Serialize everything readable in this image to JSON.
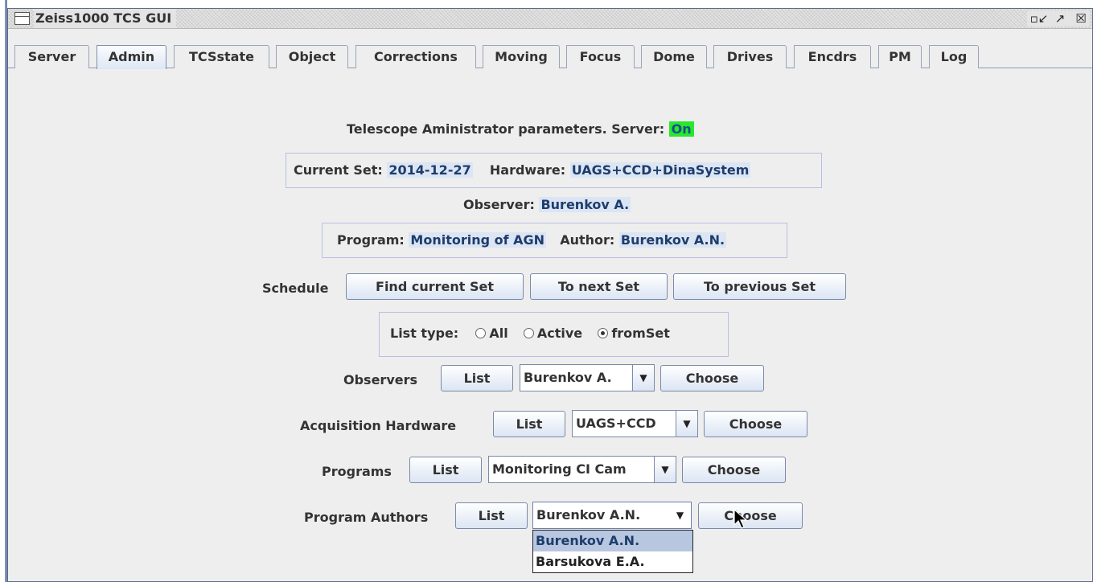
{
  "window": {
    "title": "Zeiss1000 TCS GUI",
    "controls": [
      "▫↙",
      "↗",
      "☒"
    ]
  },
  "tabs": [
    {
      "label": "Server",
      "selected": false
    },
    {
      "label": "Admin",
      "selected": true
    },
    {
      "label": "TCSstate",
      "selected": false
    },
    {
      "label": "Object",
      "selected": false
    },
    {
      "label": "Corrections",
      "selected": false
    },
    {
      "label": "Moving",
      "selected": false
    },
    {
      "label": "Focus",
      "selected": false
    },
    {
      "label": "Dome",
      "selected": false
    },
    {
      "label": "Drives",
      "selected": false
    },
    {
      "label": "Encdrs",
      "selected": false
    },
    {
      "label": "PM",
      "selected": false
    },
    {
      "label": "Log",
      "selected": false
    }
  ],
  "header": {
    "text": "Telescope Aministrator parameters.  Server:",
    "server_status": "On",
    "server_status_color": "#27e82c"
  },
  "current_set": {
    "label": "Current Set:",
    "value": "2014-12-27",
    "hardware_label": "Hardware:",
    "hardware_value": "UAGS+CCD+DinaSystem"
  },
  "observer": {
    "label": "Observer:",
    "value": "Burenkov A."
  },
  "program": {
    "label": "Program:",
    "value": "Monitoring of AGN",
    "author_label": "Author:",
    "author_value": "Burenkov A.N."
  },
  "schedule": {
    "label": "Schedule",
    "find_button": "Find current Set",
    "next_button": "To next Set",
    "prev_button": "To previous Set"
  },
  "list_type": {
    "label": "List type:",
    "options": [
      "All",
      "Active",
      "fromSet"
    ],
    "selected": "fromSet"
  },
  "rows": {
    "observers": {
      "label": "Observers",
      "list_button": "List",
      "combo_value": "Burenkov A.",
      "choose_button": "Choose"
    },
    "hardware": {
      "label": "Acquisition Hardware",
      "list_button": "List",
      "combo_value": "UAGS+CCD",
      "choose_button": "Choose"
    },
    "programs": {
      "label": "Programs",
      "list_button": "List",
      "combo_value": "Monitoring CI Cam",
      "choose_button": "Choose"
    },
    "authors": {
      "label": "Program Authors",
      "list_button": "List",
      "combo_value": "Burenkov A.N.",
      "choose_button": "Choose"
    }
  },
  "authors_dropdown": {
    "options": [
      "Burenkov A.N.",
      "Barsukova E.A."
    ],
    "selected": "Burenkov A.N."
  },
  "colors": {
    "value_highlight": "#dbe5f4",
    "value_text": "#1e3d6b",
    "selected_item": "#b8c7e0"
  }
}
